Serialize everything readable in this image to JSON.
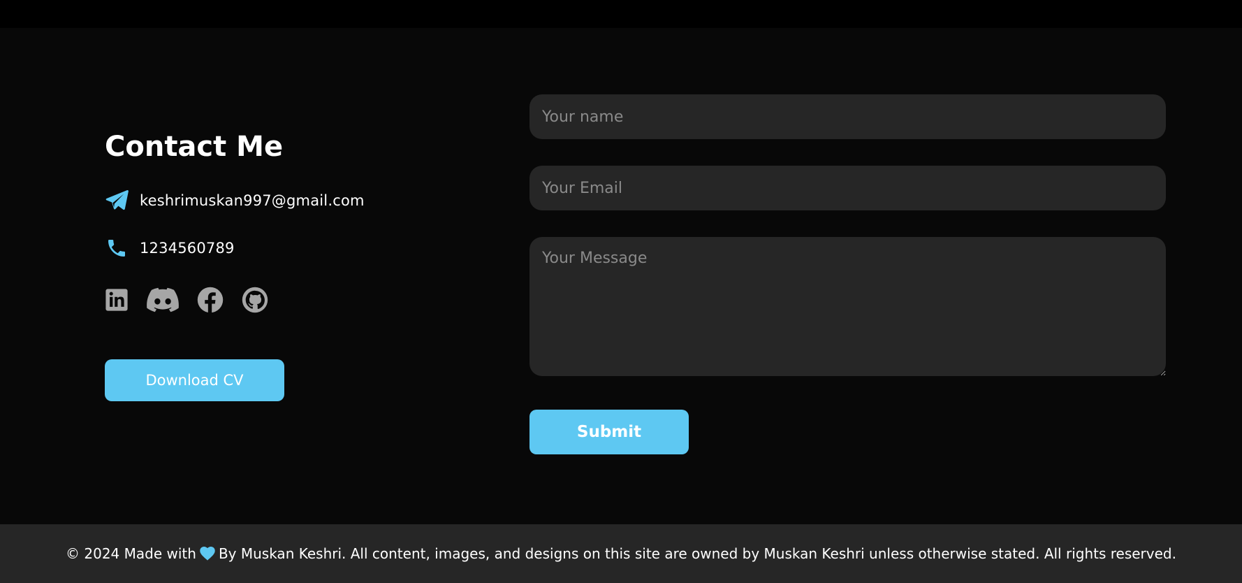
{
  "contact": {
    "title": "Contact Me",
    "email": "keshrimuskan997@gmail.com",
    "phone": "1234560789",
    "email_icon": "paper-plane-icon",
    "phone_icon": "phone-icon",
    "socials": [
      "linkedin-icon",
      "discord-icon",
      "facebook-icon",
      "github-icon"
    ],
    "cv_button": "Download CV"
  },
  "form": {
    "name_placeholder": "Your name",
    "email_placeholder": "Your Email",
    "message_placeholder": "Your Message",
    "submit_label": "Submit"
  },
  "footer": {
    "prefix": "© 2024 Made with",
    "heart_icon": "heart-icon",
    "suffix": "By Muskan Keshri. All content, images, and designs on this site are owned by Muskan Keshri unless otherwise stated. All rights reserved."
  },
  "colors": {
    "accent": "#5ec8f2",
    "background": "#080808",
    "input_background": "#262626",
    "social_icon": "#a6a6a6"
  }
}
